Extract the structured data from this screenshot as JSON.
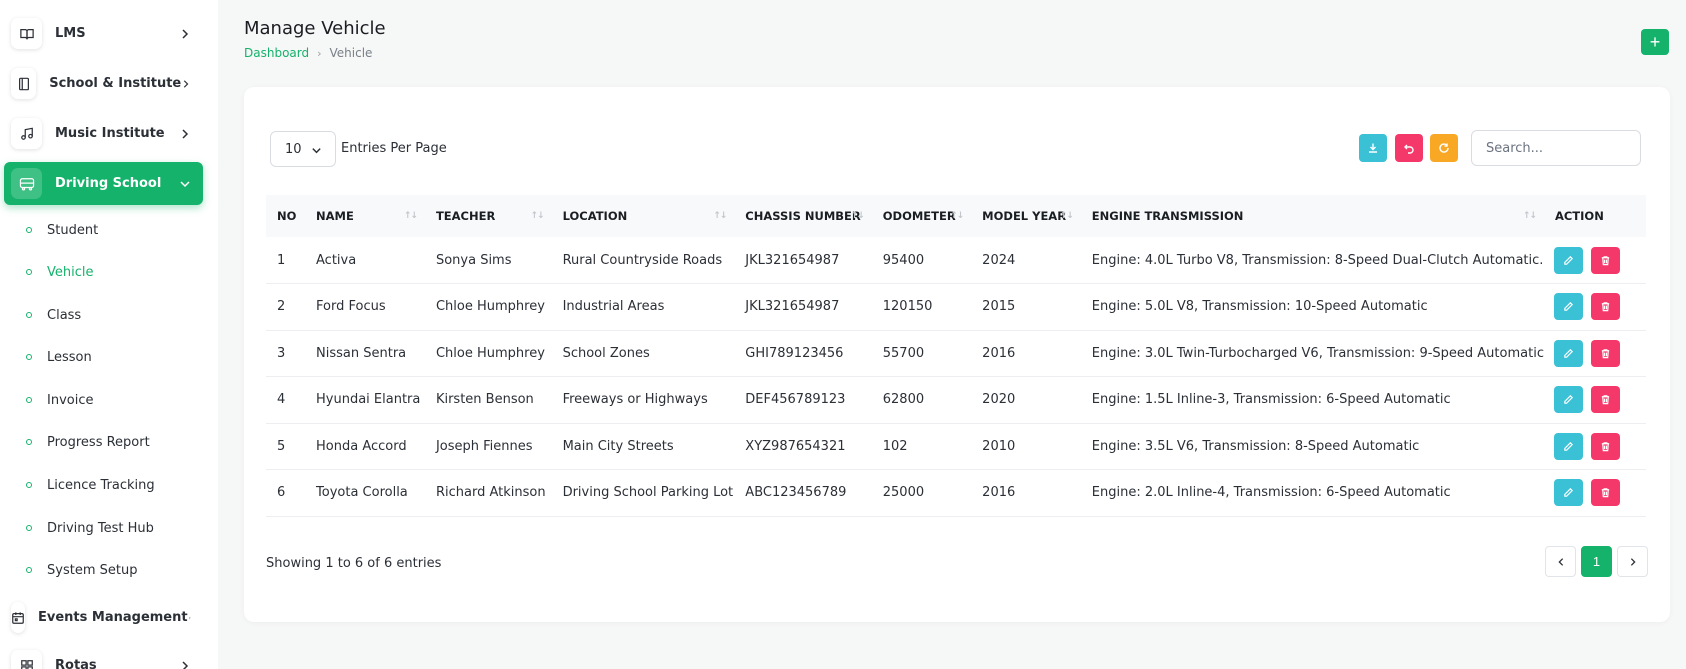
{
  "sidebar": {
    "items": [
      {
        "label": "LMS",
        "icon": "book-open-icon"
      },
      {
        "label": "School & Institute",
        "icon": "notebook-icon"
      },
      {
        "label": "Music Institute",
        "icon": "music-note-icon"
      },
      {
        "label": "Driving School",
        "icon": "bus-icon"
      },
      {
        "label": "Events Management",
        "icon": "calendar-icon"
      },
      {
        "label": "Rotas",
        "icon": "grid-icon"
      }
    ],
    "sub_items": [
      {
        "label": "Student"
      },
      {
        "label": "Vehicle"
      },
      {
        "label": "Class"
      },
      {
        "label": "Lesson"
      },
      {
        "label": "Invoice"
      },
      {
        "label": "Progress Report"
      },
      {
        "label": "Licence Tracking"
      },
      {
        "label": "Driving Test Hub"
      },
      {
        "label": "System Setup"
      }
    ],
    "active_sub": "Vehicle"
  },
  "header": {
    "title": "Manage Vehicle",
    "breadcrumb": {
      "home": "Dashboard",
      "current": "Vehicle"
    },
    "add_label": "+"
  },
  "toolbar": {
    "entries_value": "10",
    "entries_label": "Entries Per Page",
    "search_placeholder": "Search..."
  },
  "table": {
    "columns": [
      "NO",
      "NAME",
      "TEACHER",
      "LOCATION",
      "CHASSIS NUMBER",
      "ODOMETER",
      "MODEL YEAR",
      "ENGINE TRANSMISSION",
      "ACTION"
    ],
    "rows": [
      {
        "no": "1",
        "name": "Activa",
        "teacher": "Sonya Sims",
        "location": "Rural Countryside Roads",
        "chassis": "JKL321654987",
        "odometer": "95400",
        "year": "2024",
        "engine": "Engine: 4.0L Turbo V8, Transmission: 8-Speed Dual-Clutch Automatic."
      },
      {
        "no": "2",
        "name": "Ford Focus",
        "teacher": "Chloe Humphrey",
        "location": "Industrial Areas",
        "chassis": "JKL321654987",
        "odometer": "120150",
        "year": "2015",
        "engine": "Engine: 5.0L V8, Transmission: 10-Speed Automatic"
      },
      {
        "no": "3",
        "name": "Nissan Sentra",
        "teacher": "Chloe Humphrey",
        "location": "School Zones",
        "chassis": "GHI789123456",
        "odometer": "55700",
        "year": "2016",
        "engine": "Engine: 3.0L Twin-Turbocharged V6, Transmission: 9-Speed Automatic"
      },
      {
        "no": "4",
        "name": "Hyundai Elantra",
        "teacher": "Kirsten Benson",
        "location": "Freeways or Highways",
        "chassis": "DEF456789123",
        "odometer": "62800",
        "year": "2020",
        "engine": "Engine: 1.5L Inline-3, Transmission: 6-Speed Automatic"
      },
      {
        "no": "5",
        "name": "Honda Accord",
        "teacher": "Joseph Fiennes",
        "location": "Main City Streets",
        "chassis": "XYZ987654321",
        "odometer": "102",
        "year": "2010",
        "engine": "Engine: 3.5L V6, Transmission: 8-Speed Automatic"
      },
      {
        "no": "6",
        "name": "Toyota Corolla",
        "teacher": "Richard Atkinson",
        "location": "Driving School Parking Lot",
        "chassis": "ABC123456789",
        "odometer": "25000",
        "year": "2016",
        "engine": "Engine: 2.0L Inline-4, Transmission: 6-Speed Automatic"
      }
    ]
  },
  "footer": {
    "showing": "Showing 1 to 6 of 6 entries",
    "current_page": "1"
  },
  "colors": {
    "accent": "#15b26b",
    "download": "#3ac1d6",
    "undo": "#f5386a",
    "refresh": "#f9a825",
    "edit": "#3ac1d6",
    "delete": "#f5386a"
  }
}
